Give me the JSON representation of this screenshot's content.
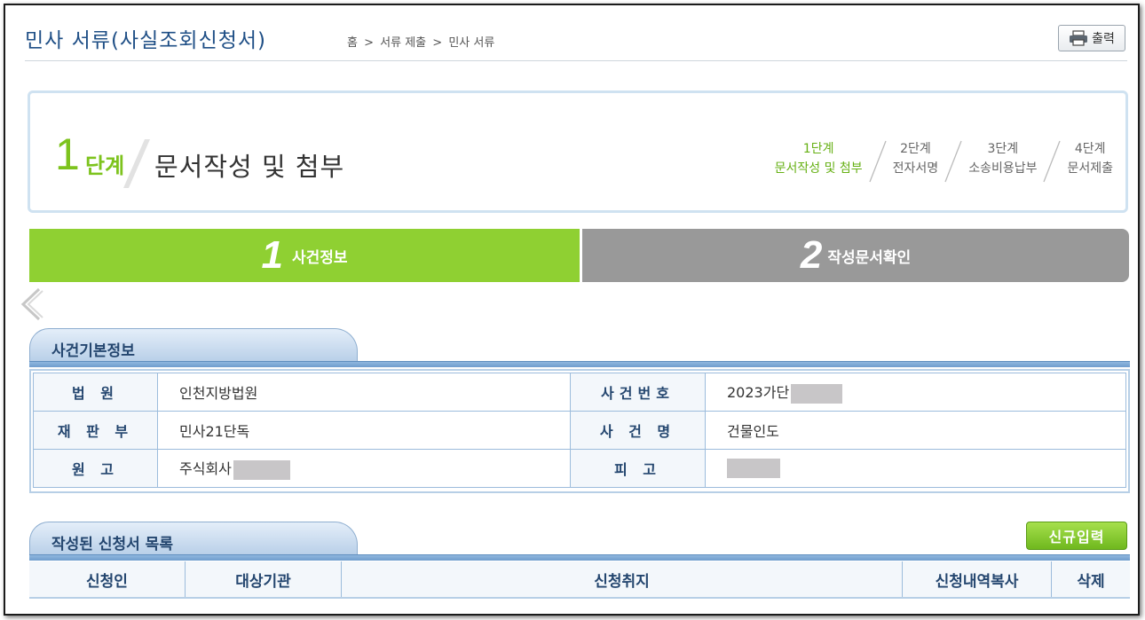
{
  "header": {
    "title": "민사 서류(사실조회신청서)",
    "breadcrumb": [
      "홈",
      ">",
      "서류 제출",
      ">",
      "민사 서류"
    ],
    "print_label": "출력"
  },
  "step": {
    "number": "1",
    "unit": "단계",
    "title": "문서작성 및 첨부",
    "nav": [
      {
        "line1": "1단계",
        "line2": "문서작성 및 첨부",
        "active": true
      },
      {
        "line1": "2단계",
        "line2": "전자서명",
        "active": false
      },
      {
        "line1": "3단계",
        "line2": "소송비용납부",
        "active": false
      },
      {
        "line1": "4단계",
        "line2": "문서제출",
        "active": false
      }
    ]
  },
  "tabs": [
    {
      "num": "1",
      "label": "사건정보",
      "active": true
    },
    {
      "num": "2",
      "label": "작성문서확인",
      "active": false
    }
  ],
  "case_info": {
    "section_title": "사건기본정보",
    "rows": [
      {
        "l1": "법 원",
        "v1": "인천지방법원",
        "l2": "사건번호",
        "v2": "2023가단"
      },
      {
        "l1": "재 판 부",
        "v1": "민사21단독",
        "l2": "사 건 명",
        "v2": "건물인도"
      },
      {
        "l1": "원 고",
        "v1": "주식회사",
        "l2": "피 고",
        "v2": ""
      }
    ]
  },
  "request_list": {
    "section_title": "작성된 신청서 목록",
    "new_button": "신규입력",
    "columns": [
      "신청인",
      "대상기관",
      "신청취지",
      "신청내역복사",
      "삭제"
    ]
  },
  "colors": {
    "title_blue": "#1f4f86",
    "green": "#8fd032",
    "gray_tab": "#999999",
    "step_green": "#7dc31d"
  }
}
